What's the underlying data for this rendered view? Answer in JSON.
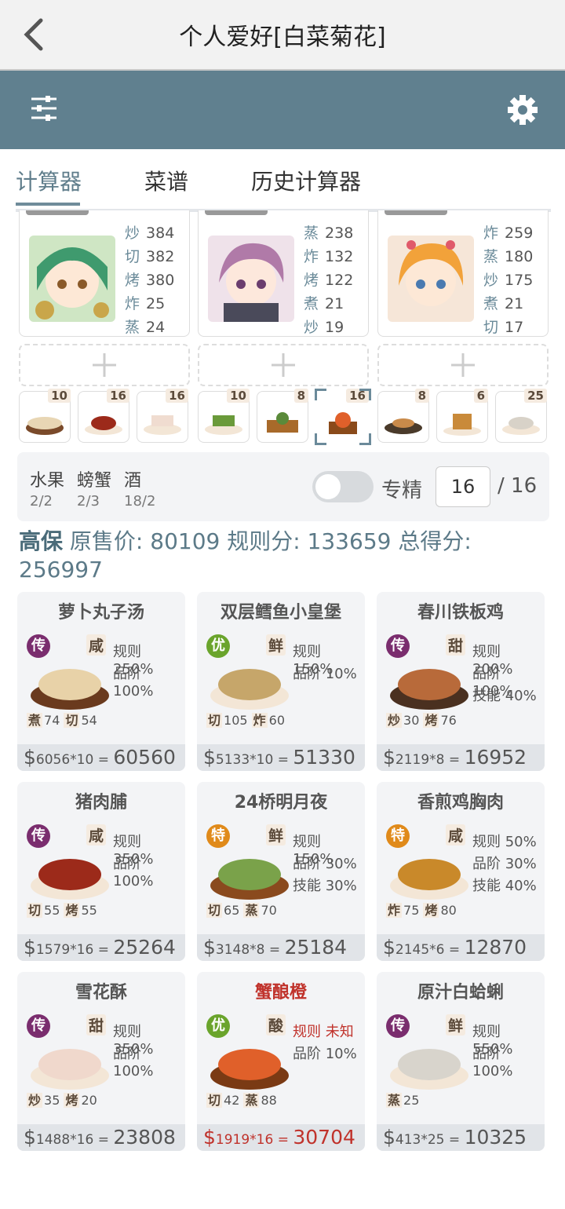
{
  "header": {
    "title": "个人爱好[白菜菊花]"
  },
  "tabs": [
    {
      "label": "计算器"
    },
    {
      "label": "菜谱"
    },
    {
      "label": "历史计算器"
    }
  ],
  "chefs": [
    {
      "skills": [
        {
          "k": "炒",
          "v": "384"
        },
        {
          "k": "切",
          "v": "382"
        },
        {
          "k": "烤",
          "v": "380"
        },
        {
          "k": "炸",
          "v": "25"
        },
        {
          "k": "蒸",
          "v": "24"
        }
      ]
    },
    {
      "skills": [
        {
          "k": "蒸",
          "v": "238"
        },
        {
          "k": "炸",
          "v": "132"
        },
        {
          "k": "烤",
          "v": "122"
        },
        {
          "k": "煮",
          "v": "21"
        },
        {
          "k": "炒",
          "v": "19"
        }
      ]
    },
    {
      "skills": [
        {
          "k": "炸",
          "v": "259"
        },
        {
          "k": "蒸",
          "v": "180"
        },
        {
          "k": "炒",
          "v": "175"
        },
        {
          "k": "煮",
          "v": "21"
        },
        {
          "k": "切",
          "v": "17"
        }
      ]
    }
  ],
  "dish_counts": [
    "10",
    "16",
    "16",
    "10",
    "8",
    "16",
    "8",
    "6",
    "25"
  ],
  "limits": [
    {
      "name": "水果",
      "val": "2/2"
    },
    {
      "name": "螃蟹",
      "val": "2/3"
    },
    {
      "name": "酒",
      "val": "18/2"
    }
  ],
  "zhuanjing": {
    "label": "专精",
    "value": "16",
    "denominator": "/ 16"
  },
  "summary": {
    "prefix": "高保",
    "text": " 原售价: 80109 规则分: 133659 总得分: 256997"
  },
  "recipes": [
    {
      "name": "萝卜丸子汤",
      "rarity": "传",
      "taste": "咸",
      "attrs": [
        "规则 250%",
        "品阶 100%"
      ],
      "req": [
        {
          "k": "煮",
          "v": "74"
        },
        {
          "k": "切",
          "v": "54"
        }
      ],
      "price": "6056",
      "mult": "*10",
      "total": "60560"
    },
    {
      "name": "双层鳕鱼小皇堡",
      "rarity": "优",
      "taste": "鲜",
      "attrs": [
        "规则 150%",
        "品阶 10%"
      ],
      "req": [
        {
          "k": "切",
          "v": "105"
        },
        {
          "k": "炸",
          "v": "60"
        }
      ],
      "price": "5133",
      "mult": "*10",
      "total": "51330"
    },
    {
      "name": "春川铁板鸡",
      "rarity": "传",
      "taste": "甜",
      "attrs": [
        "规则 200%",
        "品阶 100%",
        "技能 40%"
      ],
      "req": [
        {
          "k": "炒",
          "v": "30"
        },
        {
          "k": "烤",
          "v": "76"
        }
      ],
      "price": "2119",
      "mult": "*8",
      "total": "16952"
    },
    {
      "name": "猪肉脯",
      "rarity": "传",
      "taste": "咸",
      "attrs": [
        "规则 350%",
        "品阶 100%"
      ],
      "req": [
        {
          "k": "切",
          "v": "55"
        },
        {
          "k": "烤",
          "v": "55"
        }
      ],
      "price": "1579",
      "mult": "*16",
      "total": "25264"
    },
    {
      "name": "24桥明月夜",
      "rarity": "特",
      "taste": "鲜",
      "attrs": [
        "规则 150%",
        "品阶 30%",
        "技能 30%"
      ],
      "req": [
        {
          "k": "切",
          "v": "65"
        },
        {
          "k": "蒸",
          "v": "70"
        }
      ],
      "price": "3148",
      "mult": "*8",
      "total": "25184"
    },
    {
      "name": "香煎鸡胸肉",
      "rarity": "特",
      "taste": "咸",
      "attrs": [
        "规则 50%",
        "品阶 30%",
        "技能 40%"
      ],
      "req": [
        {
          "k": "炸",
          "v": "75"
        },
        {
          "k": "烤",
          "v": "80"
        }
      ],
      "price": "2145",
      "mult": "*6",
      "total": "12870"
    },
    {
      "name": "雪花酥",
      "rarity": "传",
      "taste": "甜",
      "attrs": [
        "规则 350%",
        "品阶 100%"
      ],
      "req": [
        {
          "k": "炒",
          "v": "35"
        },
        {
          "k": "烤",
          "v": "20"
        }
      ],
      "price": "1488",
      "mult": "*16",
      "total": "23808"
    },
    {
      "name": "蟹酿橙",
      "rarity": "优",
      "taste": "酸",
      "attrs": [
        "规则 未知",
        "品阶 10%"
      ],
      "req": [
        {
          "k": "切",
          "v": "42"
        },
        {
          "k": "蒸",
          "v": "88"
        }
      ],
      "price": "1919",
      "mult": "*16",
      "total": "30704"
    },
    {
      "name": "原汁白蛤蜊",
      "rarity": "传",
      "taste": "鲜",
      "attrs": [
        "规则 550%",
        "品阶 100%"
      ],
      "req": [
        {
          "k": "蒸",
          "v": "25"
        }
      ],
      "price": "413",
      "mult": "*25",
      "total": "10325"
    }
  ],
  "colors": {
    "rarity_chuan": "#7a2d6e",
    "rarity_you": "#6aa42c",
    "rarity_te": "#e08a1a",
    "toolbar": "#60808f",
    "highlight": "#c0322b"
  }
}
